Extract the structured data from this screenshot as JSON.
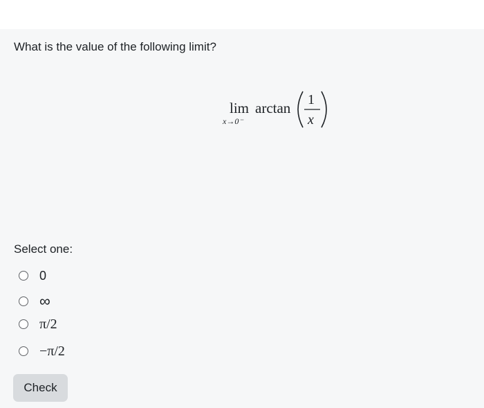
{
  "question": {
    "text": "What is the value of the following limit?"
  },
  "formula": {
    "operator": "lim",
    "subscript": "x→0⁻",
    "function": "arctan",
    "numerator": "1",
    "denominator": "x"
  },
  "answer": {
    "prompt": "Select one:",
    "options": [
      {
        "label": "0"
      },
      {
        "label": "∞"
      },
      {
        "label": "π/2"
      },
      {
        "label": "−π/2"
      }
    ]
  },
  "actions": {
    "check_label": "Check"
  },
  "colors": {
    "card_background": "#f6f7f8",
    "button_background": "#d8dbde",
    "text": "#1d2125"
  }
}
